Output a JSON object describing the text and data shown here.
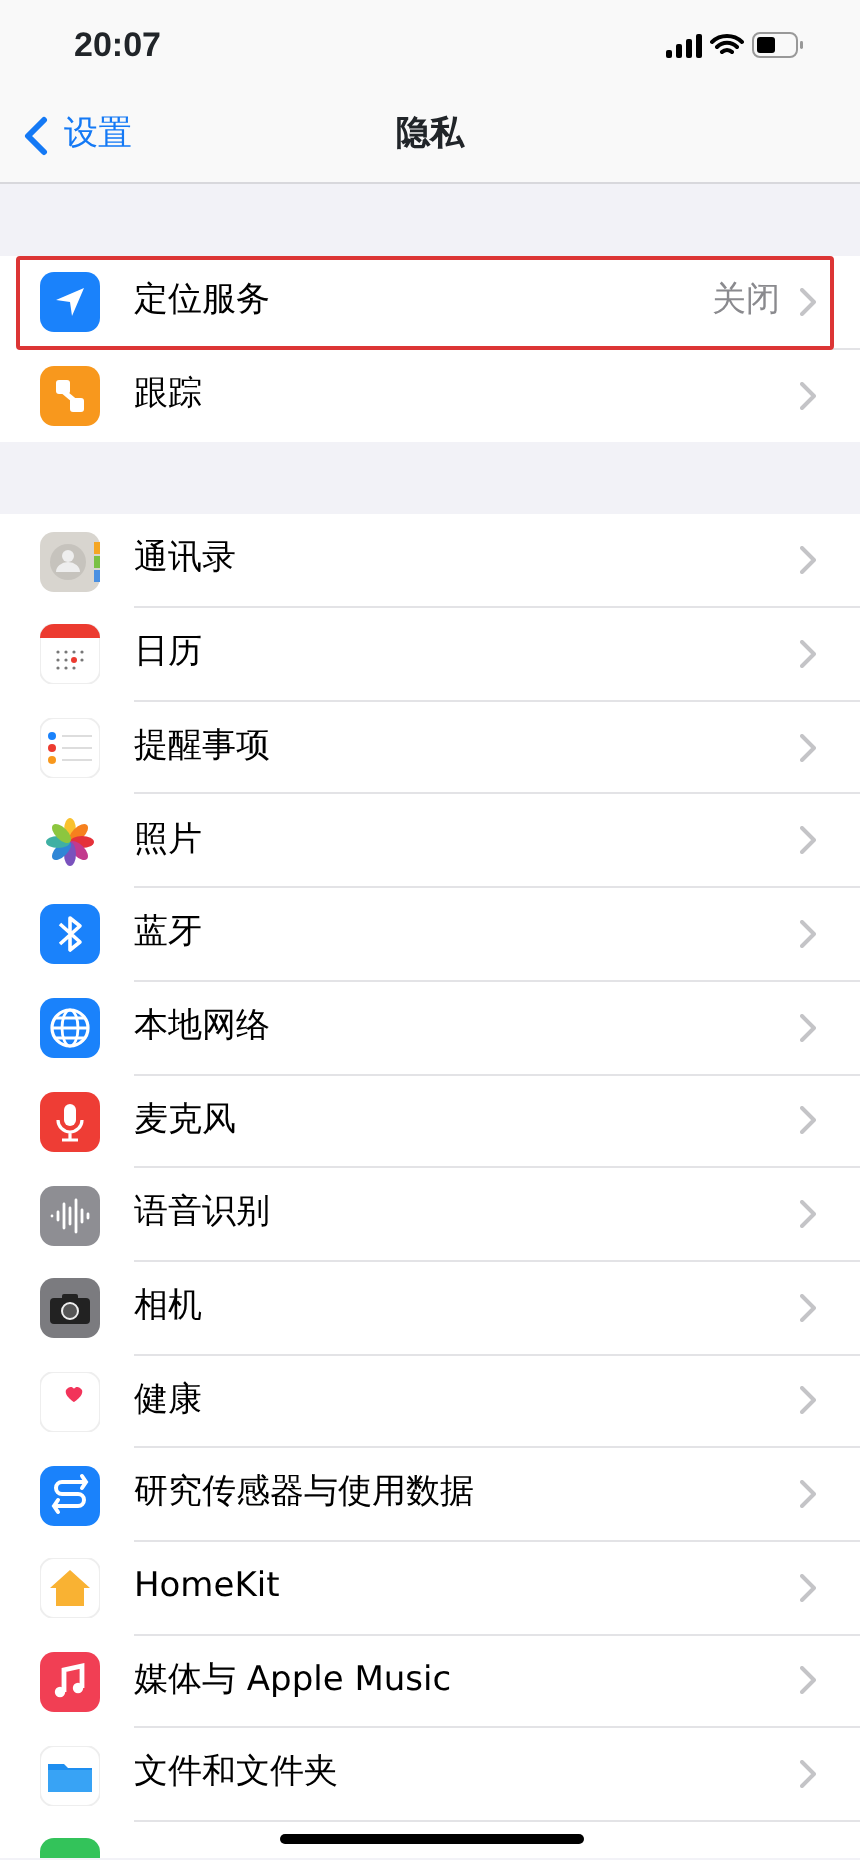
{
  "status_bar": {
    "time": "20:07"
  },
  "nav": {
    "back_label": "设置",
    "title": "隐私"
  },
  "groups": [
    {
      "items": [
        {
          "label": "定位服务",
          "value": "关闭",
          "highlighted": true
        },
        {
          "label": "跟踪",
          "highlighted": false
        }
      ]
    },
    {
      "items": [
        {
          "label": "通讯录",
          "highlighted": false
        },
        {
          "label": "日历",
          "highlighted": false
        },
        {
          "label": "提醒事项",
          "highlighted": false
        },
        {
          "label": "照片",
          "highlighted": false
        },
        {
          "label": "蓝牙",
          "highlighted": false
        },
        {
          "label": "本地网络",
          "highlighted": false
        },
        {
          "label": "麦克风",
          "highlighted": false
        },
        {
          "label": "语音识别",
          "highlighted": false
        },
        {
          "label": "相机",
          "highlighted": false
        },
        {
          "label": "健康",
          "highlighted": false
        },
        {
          "label": "研究传感器与使用数据",
          "highlighted": false
        },
        {
          "label": "HomeKit",
          "highlighted": false
        },
        {
          "label": "媒体与 Apple Music",
          "highlighted": false
        },
        {
          "label": "文件和文件夹",
          "highlighted": false
        },
        {
          "highlighted": false
        }
      ]
    }
  ]
}
